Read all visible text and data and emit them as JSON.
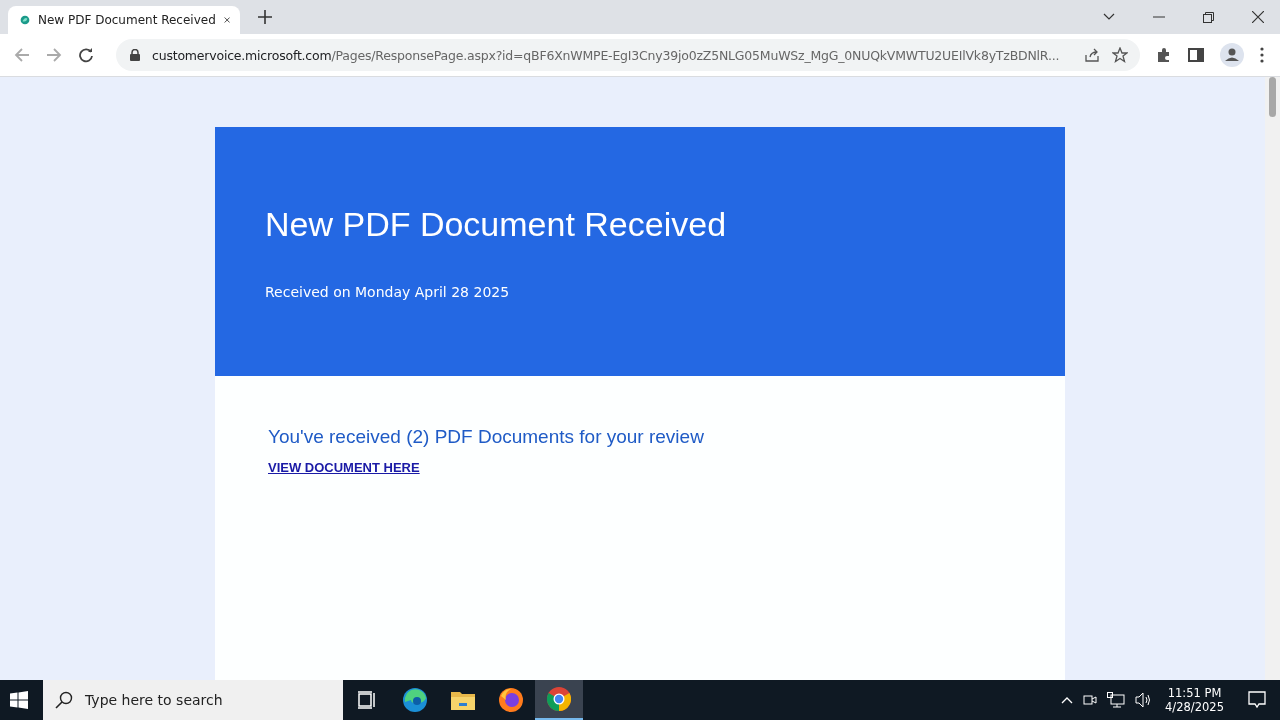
{
  "browser": {
    "tab": {
      "title": "New PDF Document Received",
      "selected": true
    },
    "url": {
      "host": "customervoice.microsoft.com",
      "path": "/Pages/ResponsePage.aspx?id=qBF6XnWMPE-EgI3Cny39jo0zZ5NLG05MuWSz_MgG_0NUQkVMWTU2UEIlVk8yTzBDNlR..."
    }
  },
  "page": {
    "header": {
      "title": "New PDF Document Received",
      "subtitle": "Received on Monday April 28 2025"
    },
    "body": {
      "message": "You've received (2) PDF Documents for your review",
      "link": "VIEW DOCUMENT HERE"
    }
  },
  "taskbar": {
    "search": {
      "placeholder": "Type here to search"
    },
    "apps": [
      {
        "kind": "taskview",
        "selected": false
      },
      {
        "kind": "edge",
        "selected": false
      },
      {
        "kind": "folder",
        "selected": false
      },
      {
        "kind": "firefox",
        "selected": false
      },
      {
        "kind": "chrome",
        "selected": true
      }
    ],
    "clock": {
      "time": "11:51 PM",
      "date": "4/28/2025"
    }
  }
}
